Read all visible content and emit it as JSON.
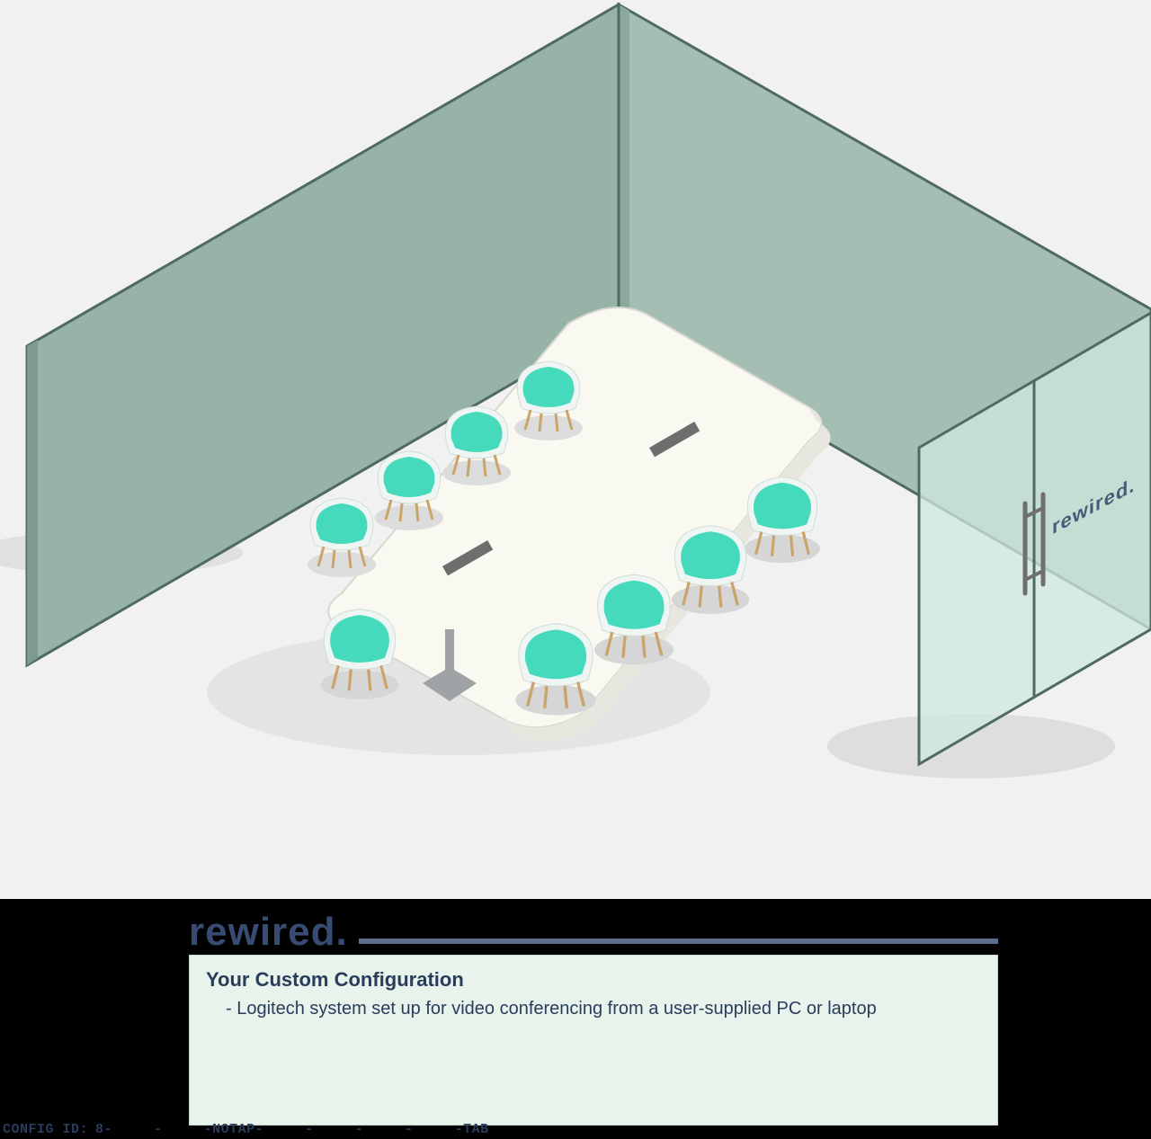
{
  "brand": "rewired.",
  "door_brand": "rewired.",
  "panel": {
    "title": "Your Custom Configuration",
    "items": [
      "Logitech system set up for video conferencing from a user-supplied PC or laptop"
    ]
  },
  "config_id": {
    "label": "CONFIG ID:",
    "segments": [
      "8",
      "",
      "",
      "NOTAP",
      "",
      "",
      "",
      "",
      "TAB"
    ]
  },
  "colors": {
    "wall_fill": "#a5beb3",
    "wall_edge": "#4f6a5f",
    "glass_fill": "#cfe8de",
    "chair_seat": "#45dabc",
    "chair_shell": "#eef5f3",
    "table_top": "#f9f8f1",
    "floor": "#f1f1f1",
    "brand_text": "#384b72",
    "panel_bg": "#e8f3ec"
  }
}
